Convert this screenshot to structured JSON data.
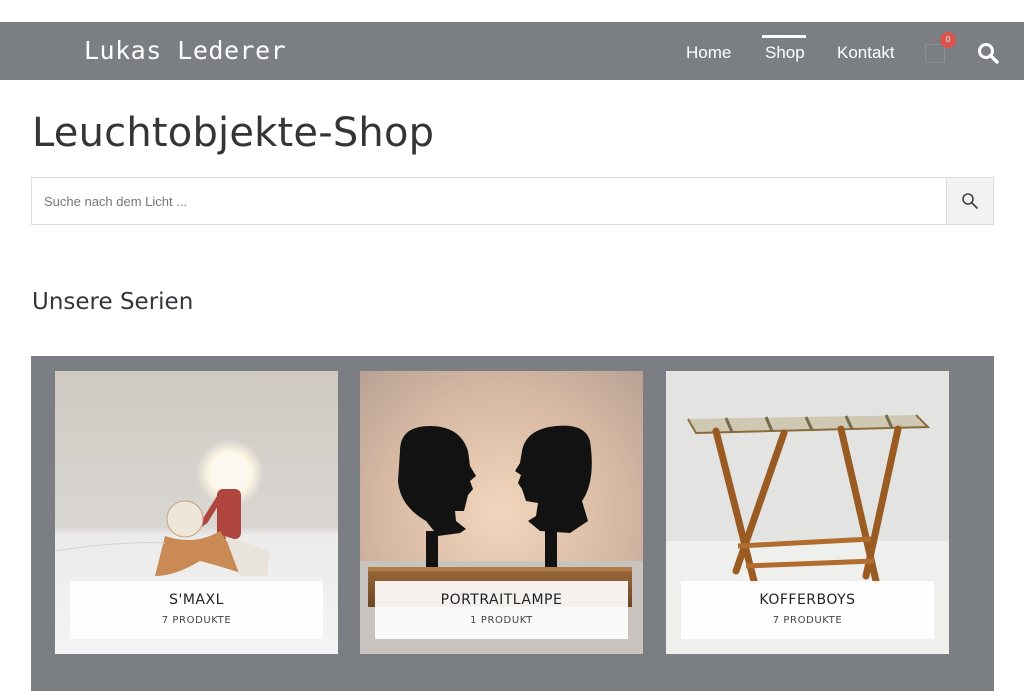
{
  "header": {
    "logo": "Lukas Lederer",
    "nav": [
      {
        "label": "Home"
      },
      {
        "label": "Shop",
        "active": true
      },
      {
        "label": "Kontakt"
      }
    ],
    "cart_count": "0",
    "icons": {
      "cart": "shopping-bag-icon",
      "search": "search-icon"
    },
    "accent_color": "#d9534f",
    "bar_color": "#7b7f83"
  },
  "main": {
    "title": "Leuchtobjekte-Shop",
    "search": {
      "placeholder": "Suche nach dem Licht ...",
      "value": ""
    },
    "section_title": "Unsere Serien",
    "series": [
      {
        "name": "S'MAXL",
        "count": "7 PRODUKTE"
      },
      {
        "name": "PORTRAITLAMPE",
        "count": "1 PRODUKT"
      },
      {
        "name": "KOFFERBOYS",
        "count": "7 PRODUKTE"
      }
    ]
  }
}
